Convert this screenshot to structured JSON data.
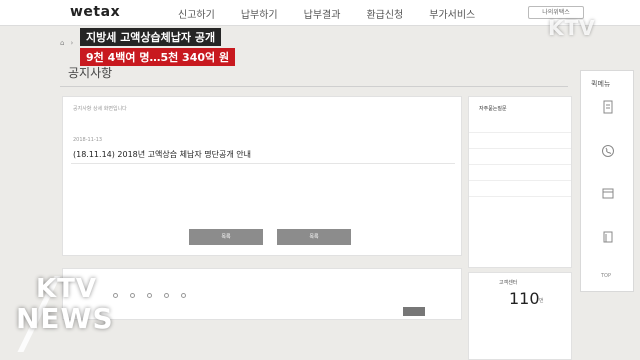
{
  "header": {
    "logo": "wetax",
    "nav": [
      "신고하기",
      "납부하기",
      "납부결과",
      "환급신청",
      "부가서비스"
    ],
    "myinfo_label": "나의위택스"
  },
  "broadcast": {
    "caption_line1": "지방세 고액상습체납자 공개",
    "caption_line2": "9천 4백여 명…5천 340억 원",
    "channel_logo": "KTV",
    "news_logo_top": "KTV",
    "news_logo_bottom": "NEWS"
  },
  "page": {
    "title": "공지사항"
  },
  "post": {
    "notice_top": "공지사항 상세 화면입니다",
    "date": "2018-11-13",
    "title": "(18.11.14) 2018년 고액상습 체납자 명단공개 안내",
    "buttons": [
      "목록",
      "목록"
    ]
  },
  "sidebar": {
    "heading": "자주묻는질문",
    "date_heading": "고객센터",
    "date_number": "110",
    "date_unit": "번"
  },
  "quickmenu": {
    "title": "퀵메뉴",
    "top_label": "TOP"
  }
}
